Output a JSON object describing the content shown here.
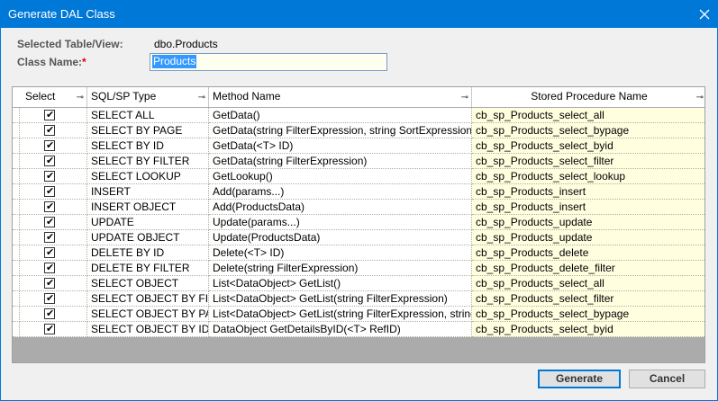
{
  "window": {
    "title": "Generate DAL Class",
    "close_icon": "close-icon"
  },
  "form": {
    "table_label": "Selected Table/View:",
    "table_value": "dbo.Products",
    "class_label": "Class Name:",
    "required_mark": "*",
    "class_value": "Products"
  },
  "grid": {
    "headers": {
      "select": "Select",
      "type": "SQL/SP Type",
      "method": "Method Name",
      "proc": "Stored Procedure Name"
    },
    "rows": [
      {
        "checked": true,
        "type": "SELECT ALL",
        "method": "GetData()",
        "proc": "cb_sp_Products_select_all"
      },
      {
        "checked": true,
        "type": "SELECT BY PAGE",
        "method": "GetData(string FilterExpression, string SortExpression, i",
        "proc": "cb_sp_Products_select_bypage"
      },
      {
        "checked": true,
        "type": "SELECT BY ID",
        "method": "GetData(<T> ID)",
        "proc": "cb_sp_Products_select_byid"
      },
      {
        "checked": true,
        "type": "SELECT BY FILTER",
        "method": "GetData(string FilterExpression)",
        "proc": "cb_sp_Products_select_filter"
      },
      {
        "checked": true,
        "type": "SELECT LOOKUP",
        "method": "GetLookup()",
        "proc": "cb_sp_Products_select_lookup"
      },
      {
        "checked": true,
        "type": "INSERT",
        "method": "Add(params...)",
        "proc": "cb_sp_Products_insert"
      },
      {
        "checked": true,
        "type": "INSERT OBJECT",
        "method": "Add(ProductsData)",
        "proc": "cb_sp_Products_insert"
      },
      {
        "checked": true,
        "type": "UPDATE",
        "method": "Update(params...)",
        "proc": "cb_sp_Products_update"
      },
      {
        "checked": true,
        "type": "UPDATE OBJECT",
        "method": "Update(ProductsData)",
        "proc": "cb_sp_Products_update"
      },
      {
        "checked": true,
        "type": "DELETE BY ID",
        "method": "Delete(<T> ID)",
        "proc": "cb_sp_Products_delete"
      },
      {
        "checked": true,
        "type": "DELETE BY FILTER",
        "method": "Delete(string FilterExpression)",
        "proc": "cb_sp_Products_delete_filter"
      },
      {
        "checked": true,
        "type": "SELECT OBJECT",
        "method": "List<DataObject> GetList()",
        "proc": "cb_sp_Products_select_all"
      },
      {
        "checked": true,
        "type": "SELECT OBJECT BY FILT",
        "method": "List<DataObject> GetList(string FilterExpression)",
        "proc": "cb_sp_Products_select_filter"
      },
      {
        "checked": true,
        "type": "SELECT OBJECT BY PAG",
        "method": "List<DataObject> GetList(string FilterExpression, string",
        "proc": "cb_sp_Products_select_bypage"
      },
      {
        "checked": true,
        "type": "SELECT OBJECT BY ID",
        "method": "DataObject GetDetailsByID(<T> RefID)",
        "proc": "cb_sp_Products_select_byid"
      }
    ]
  },
  "buttons": {
    "generate": "Generate",
    "cancel": "Cancel"
  },
  "colors": {
    "titlebar": "#0078d7",
    "proc_cell_bg": "#ffffe0",
    "grid_bg": "#ababab"
  }
}
